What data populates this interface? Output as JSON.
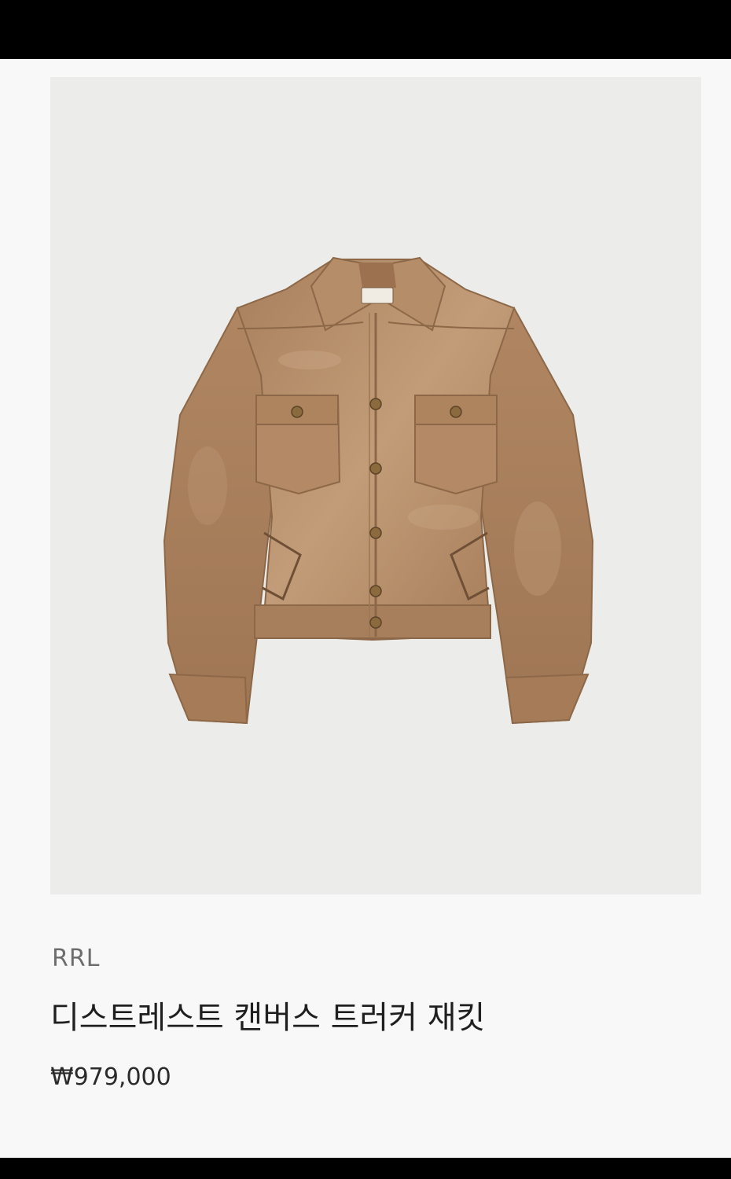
{
  "product": {
    "image_alt": "jacket-photo",
    "brand": "RRL",
    "name": "디스트레스트 캔버스 트러커 재킷",
    "price": "₩979,000"
  },
  "colors": {
    "page_background": "#f8f8f8",
    "image_background": "#ececea",
    "jacket": "#b48a66",
    "bars": "#000000"
  }
}
